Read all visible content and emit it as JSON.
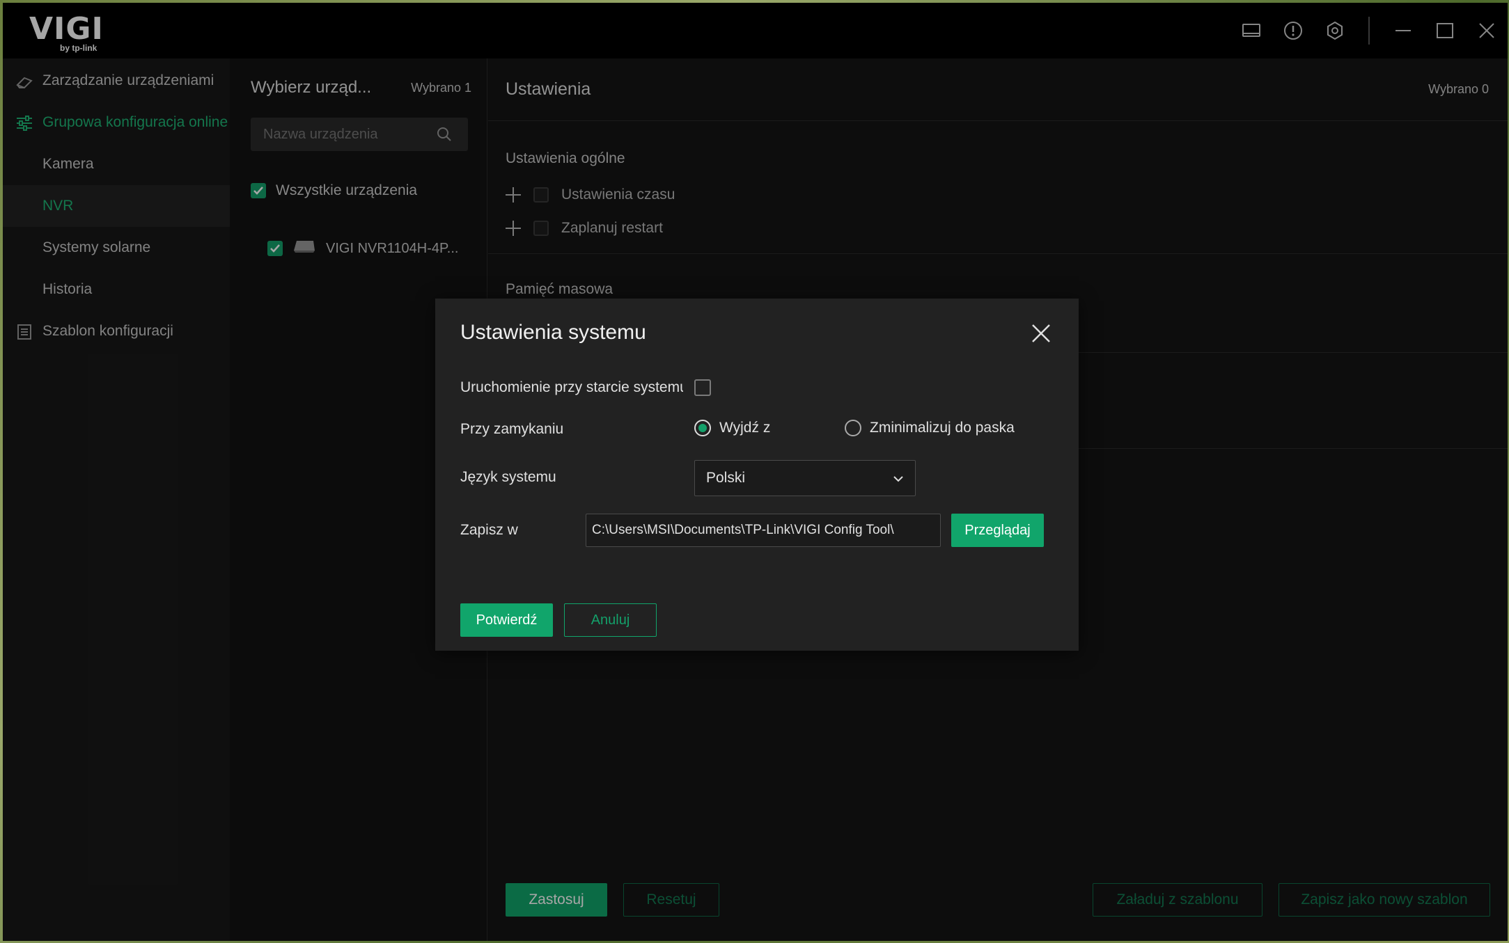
{
  "titlebar": {
    "logo_main": "VIGI",
    "logo_sub": "by tp-link",
    "icons": [
      "monitor-icon",
      "alert-icon",
      "settings-icon",
      "minimize-icon",
      "maximize-icon",
      "close-icon"
    ]
  },
  "sidebar": {
    "items": [
      {
        "label": "Zarządzanie urządzeniami",
        "icon": "device-management-icon"
      },
      {
        "label": "Grupowa konfiguracja online",
        "icon": "sliders-icon"
      },
      {
        "label": "Kamera"
      },
      {
        "label": "NVR"
      },
      {
        "label": "Systemy solarne"
      },
      {
        "label": "Historia"
      },
      {
        "label": "Szablon konfiguracji",
        "icon": "template-icon"
      }
    ]
  },
  "devices": {
    "title": "Wybierz urząd...",
    "selected_count": "Wybrano 1",
    "search_placeholder": "Nazwa urządzenia",
    "all_label": "Wszystkie urządzenia",
    "items": [
      {
        "name": "VIGI NVR1104H-4P..."
      }
    ]
  },
  "settings": {
    "title": "Ustawienia",
    "selected_count": "Wybrano 0",
    "general_title": "Ustawienia ogólne",
    "general_items": [
      "Ustawienia czasu",
      "Zaplanuj restart"
    ],
    "storage_title": "Pamięć masowa",
    "footer": {
      "apply": "Zastosuj",
      "reset": "Resetuj",
      "load_template": "Załaduj z szablonu",
      "save_template": "Zapisz jako nowy szablon"
    }
  },
  "modal": {
    "title": "Ustawienia systemu",
    "startup_label": "Uruchomienie przy starcie systemu",
    "close_label": "Przy zamykaniu",
    "close_options": [
      "Wyjdź z",
      "Zminimalizuj do paska"
    ],
    "language_label": "Język systemu",
    "language_value": "Polski",
    "save_label": "Zapisz w",
    "save_path": "C:\\Users\\MSI\\Documents\\TP-Link\\VIGI Config Tool\\",
    "browse": "Przeglądaj",
    "confirm": "Potwierdź",
    "cancel": "Anuluj"
  },
  "colors": {
    "accent": "#11a56b",
    "background": "#141414"
  }
}
